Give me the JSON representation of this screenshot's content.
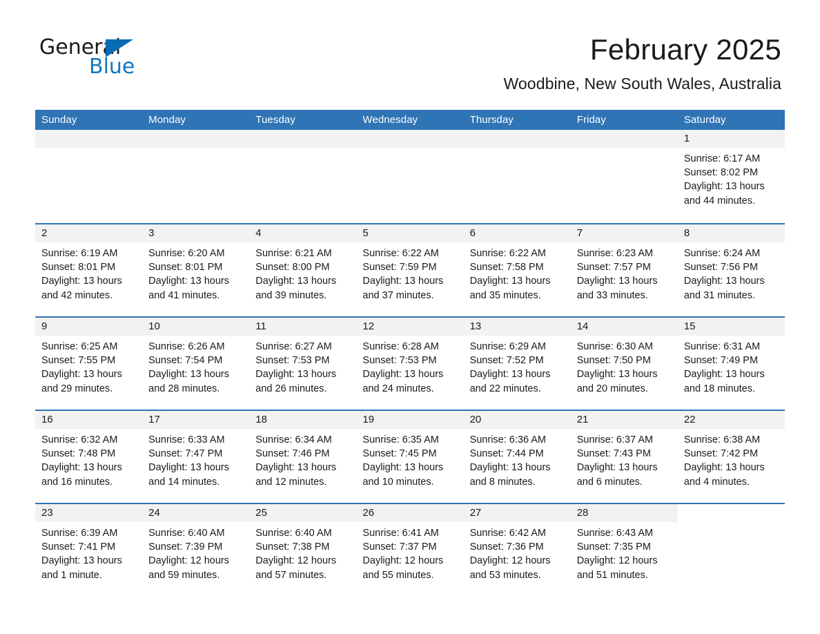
{
  "brand": {
    "word1": "General",
    "word2": "Blue",
    "triangle_color": "#0a6cb4",
    "blue_text_color": "#1277bd"
  },
  "header": {
    "month_title": "February 2025",
    "location": "Woodbine, New South Wales, Australia",
    "header_bar_color": "#2f74b5",
    "date_band_color": "#f2f2f2"
  },
  "weekday_headers": [
    "Sunday",
    "Monday",
    "Tuesday",
    "Wednesday",
    "Thursday",
    "Friday",
    "Saturday"
  ],
  "weeks": [
    [
      {
        "date": "",
        "empty": true
      },
      {
        "date": "",
        "empty": true
      },
      {
        "date": "",
        "empty": true
      },
      {
        "date": "",
        "empty": true
      },
      {
        "date": "",
        "empty": true
      },
      {
        "date": "",
        "empty": true
      },
      {
        "date": "1",
        "sunrise": "Sunrise: 6:17 AM",
        "sunset": "Sunset: 8:02 PM",
        "daylight_1": "Daylight: 13 hours",
        "daylight_2": "and 44 minutes."
      }
    ],
    [
      {
        "date": "2",
        "sunrise": "Sunrise: 6:19 AM",
        "sunset": "Sunset: 8:01 PM",
        "daylight_1": "Daylight: 13 hours",
        "daylight_2": "and 42 minutes."
      },
      {
        "date": "3",
        "sunrise": "Sunrise: 6:20 AM",
        "sunset": "Sunset: 8:01 PM",
        "daylight_1": "Daylight: 13 hours",
        "daylight_2": "and 41 minutes."
      },
      {
        "date": "4",
        "sunrise": "Sunrise: 6:21 AM",
        "sunset": "Sunset: 8:00 PM",
        "daylight_1": "Daylight: 13 hours",
        "daylight_2": "and 39 minutes."
      },
      {
        "date": "5",
        "sunrise": "Sunrise: 6:22 AM",
        "sunset": "Sunset: 7:59 PM",
        "daylight_1": "Daylight: 13 hours",
        "daylight_2": "and 37 minutes."
      },
      {
        "date": "6",
        "sunrise": "Sunrise: 6:22 AM",
        "sunset": "Sunset: 7:58 PM",
        "daylight_1": "Daylight: 13 hours",
        "daylight_2": "and 35 minutes."
      },
      {
        "date": "7",
        "sunrise": "Sunrise: 6:23 AM",
        "sunset": "Sunset: 7:57 PM",
        "daylight_1": "Daylight: 13 hours",
        "daylight_2": "and 33 minutes."
      },
      {
        "date": "8",
        "sunrise": "Sunrise: 6:24 AM",
        "sunset": "Sunset: 7:56 PM",
        "daylight_1": "Daylight: 13 hours",
        "daylight_2": "and 31 minutes."
      }
    ],
    [
      {
        "date": "9",
        "sunrise": "Sunrise: 6:25 AM",
        "sunset": "Sunset: 7:55 PM",
        "daylight_1": "Daylight: 13 hours",
        "daylight_2": "and 29 minutes."
      },
      {
        "date": "10",
        "sunrise": "Sunrise: 6:26 AM",
        "sunset": "Sunset: 7:54 PM",
        "daylight_1": "Daylight: 13 hours",
        "daylight_2": "and 28 minutes."
      },
      {
        "date": "11",
        "sunrise": "Sunrise: 6:27 AM",
        "sunset": "Sunset: 7:53 PM",
        "daylight_1": "Daylight: 13 hours",
        "daylight_2": "and 26 minutes."
      },
      {
        "date": "12",
        "sunrise": "Sunrise: 6:28 AM",
        "sunset": "Sunset: 7:53 PM",
        "daylight_1": "Daylight: 13 hours",
        "daylight_2": "and 24 minutes."
      },
      {
        "date": "13",
        "sunrise": "Sunrise: 6:29 AM",
        "sunset": "Sunset: 7:52 PM",
        "daylight_1": "Daylight: 13 hours",
        "daylight_2": "and 22 minutes."
      },
      {
        "date": "14",
        "sunrise": "Sunrise: 6:30 AM",
        "sunset": "Sunset: 7:50 PM",
        "daylight_1": "Daylight: 13 hours",
        "daylight_2": "and 20 minutes."
      },
      {
        "date": "15",
        "sunrise": "Sunrise: 6:31 AM",
        "sunset": "Sunset: 7:49 PM",
        "daylight_1": "Daylight: 13 hours",
        "daylight_2": "and 18 minutes."
      }
    ],
    [
      {
        "date": "16",
        "sunrise": "Sunrise: 6:32 AM",
        "sunset": "Sunset: 7:48 PM",
        "daylight_1": "Daylight: 13 hours",
        "daylight_2": "and 16 minutes."
      },
      {
        "date": "17",
        "sunrise": "Sunrise: 6:33 AM",
        "sunset": "Sunset: 7:47 PM",
        "daylight_1": "Daylight: 13 hours",
        "daylight_2": "and 14 minutes."
      },
      {
        "date": "18",
        "sunrise": "Sunrise: 6:34 AM",
        "sunset": "Sunset: 7:46 PM",
        "daylight_1": "Daylight: 13 hours",
        "daylight_2": "and 12 minutes."
      },
      {
        "date": "19",
        "sunrise": "Sunrise: 6:35 AM",
        "sunset": "Sunset: 7:45 PM",
        "daylight_1": "Daylight: 13 hours",
        "daylight_2": "and 10 minutes."
      },
      {
        "date": "20",
        "sunrise": "Sunrise: 6:36 AM",
        "sunset": "Sunset: 7:44 PM",
        "daylight_1": "Daylight: 13 hours",
        "daylight_2": "and 8 minutes."
      },
      {
        "date": "21",
        "sunrise": "Sunrise: 6:37 AM",
        "sunset": "Sunset: 7:43 PM",
        "daylight_1": "Daylight: 13 hours",
        "daylight_2": "and 6 minutes."
      },
      {
        "date": "22",
        "sunrise": "Sunrise: 6:38 AM",
        "sunset": "Sunset: 7:42 PM",
        "daylight_1": "Daylight: 13 hours",
        "daylight_2": "and 4 minutes."
      }
    ],
    [
      {
        "date": "23",
        "sunrise": "Sunrise: 6:39 AM",
        "sunset": "Sunset: 7:41 PM",
        "daylight_1": "Daylight: 13 hours",
        "daylight_2": "and 1 minute."
      },
      {
        "date": "24",
        "sunrise": "Sunrise: 6:40 AM",
        "sunset": "Sunset: 7:39 PM",
        "daylight_1": "Daylight: 12 hours",
        "daylight_2": "and 59 minutes."
      },
      {
        "date": "25",
        "sunrise": "Sunrise: 6:40 AM",
        "sunset": "Sunset: 7:38 PM",
        "daylight_1": "Daylight: 12 hours",
        "daylight_2": "and 57 minutes."
      },
      {
        "date": "26",
        "sunrise": "Sunrise: 6:41 AM",
        "sunset": "Sunset: 7:37 PM",
        "daylight_1": "Daylight: 12 hours",
        "daylight_2": "and 55 minutes."
      },
      {
        "date": "27",
        "sunrise": "Sunrise: 6:42 AM",
        "sunset": "Sunset: 7:36 PM",
        "daylight_1": "Daylight: 12 hours",
        "daylight_2": "and 53 minutes."
      },
      {
        "date": "28",
        "sunrise": "Sunrise: 6:43 AM",
        "sunset": "Sunset: 7:35 PM",
        "daylight_1": "Daylight: 12 hours",
        "daylight_2": "and 51 minutes."
      },
      {
        "date": "",
        "empty": true,
        "no_band": true
      }
    ]
  ]
}
